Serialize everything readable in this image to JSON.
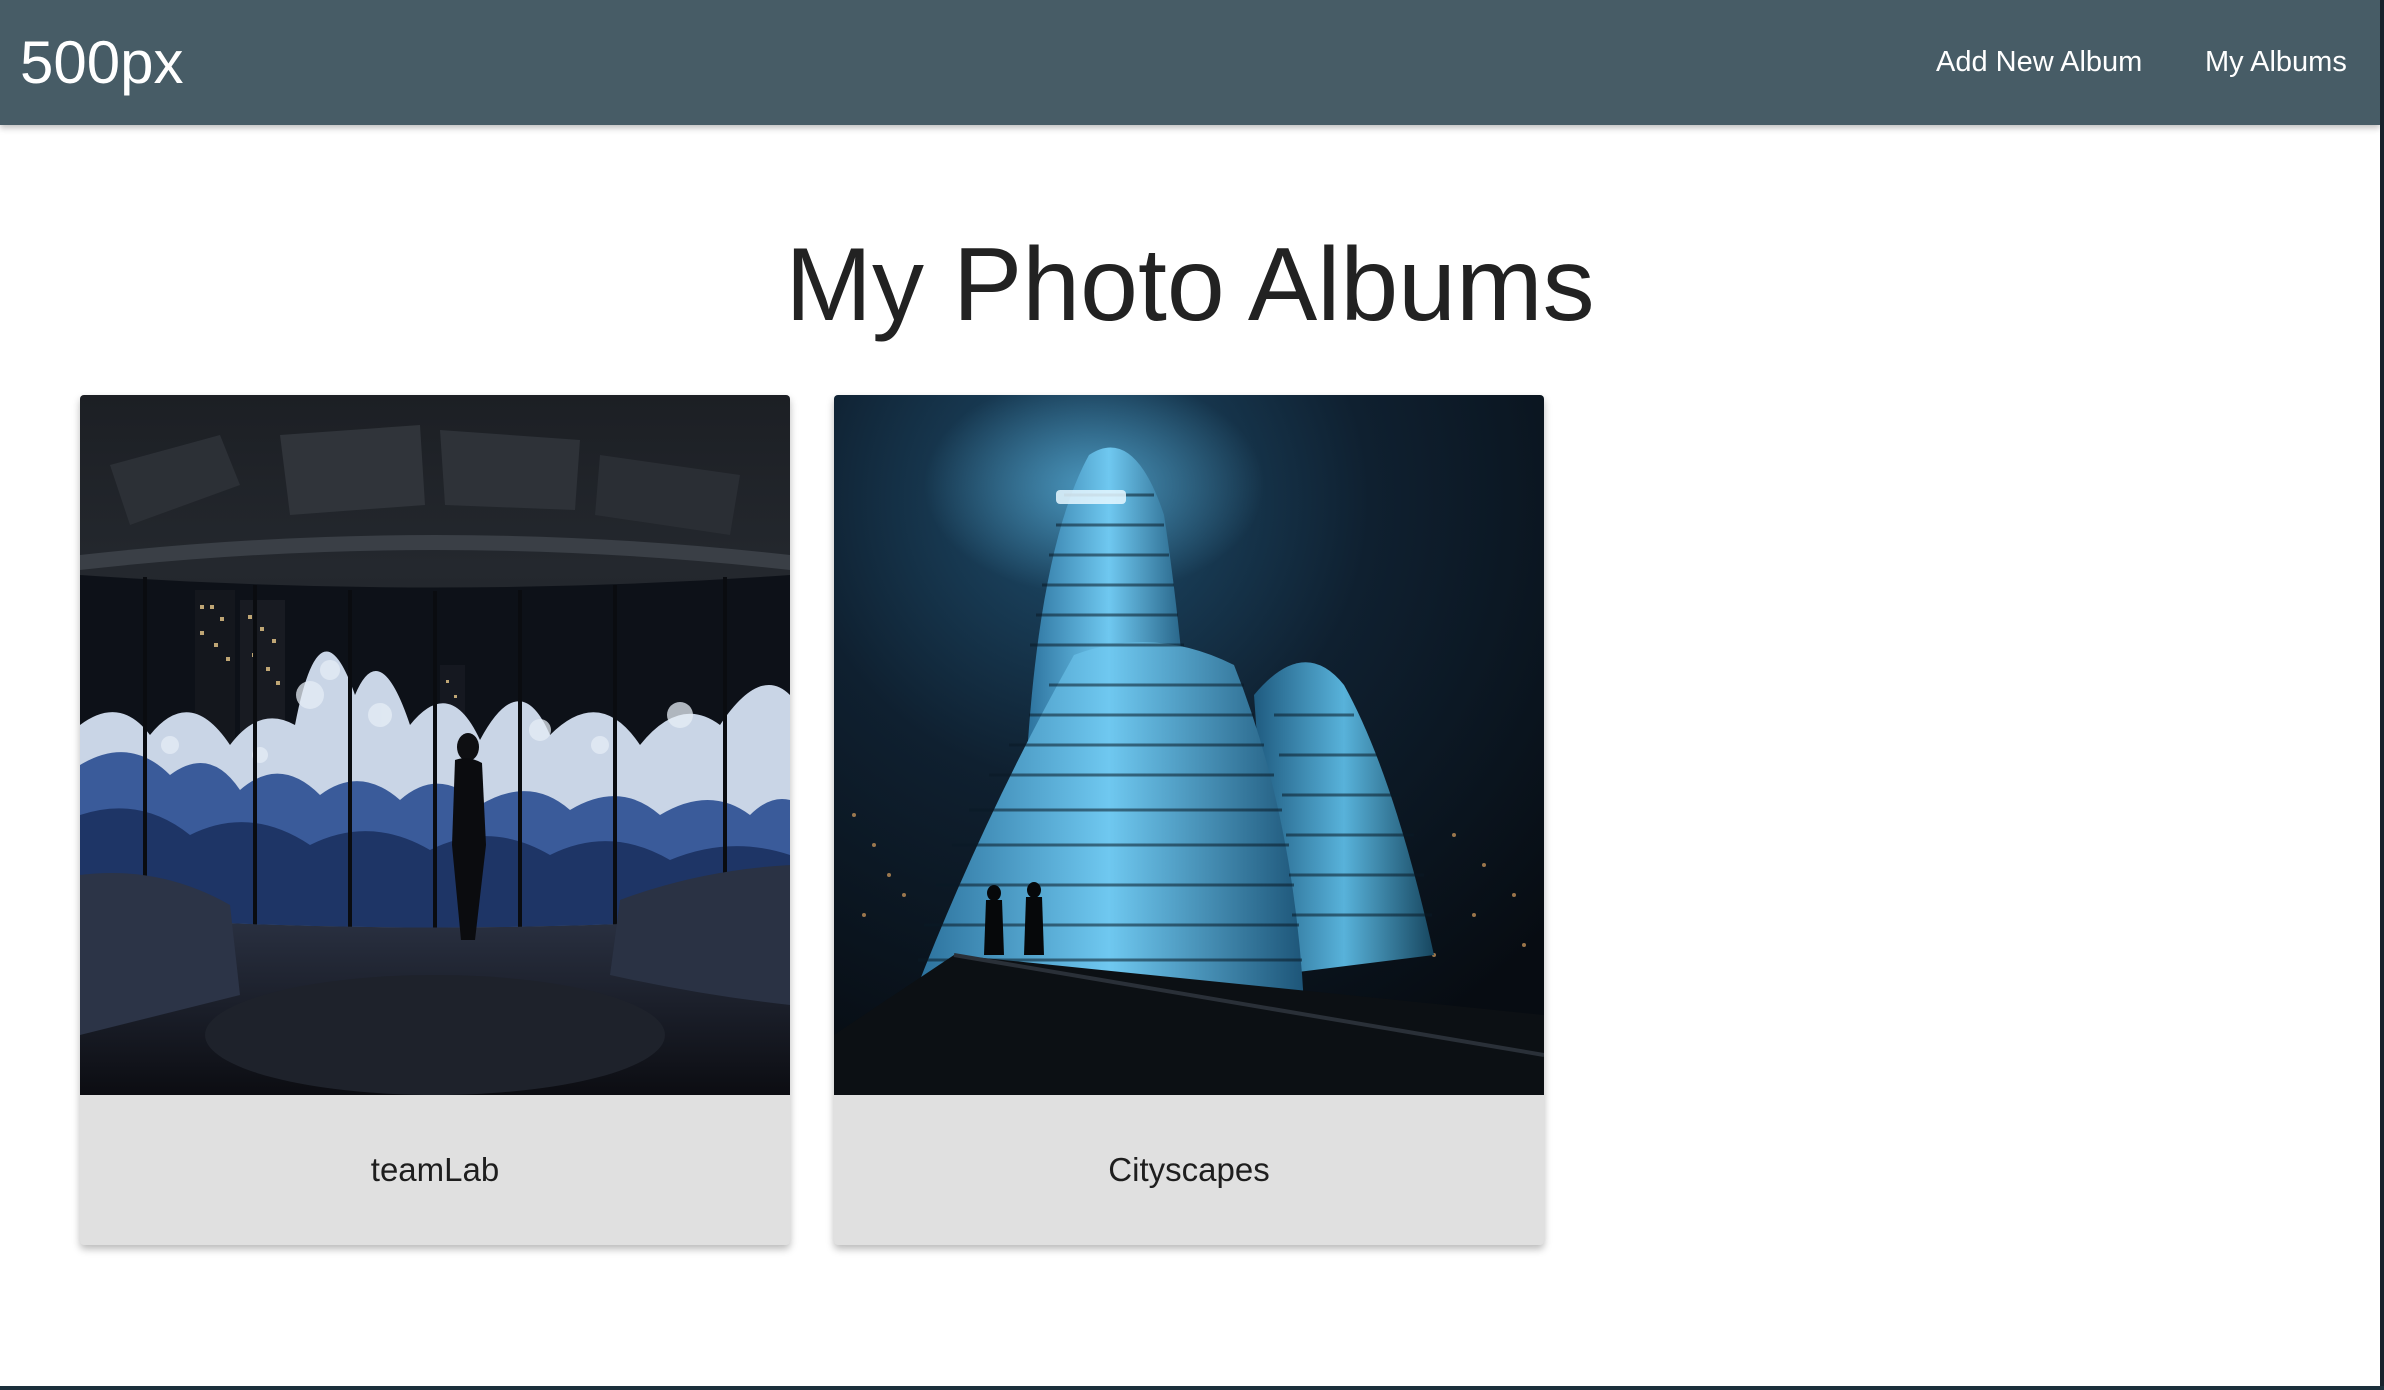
{
  "navbar": {
    "brand": "500px",
    "links": [
      {
        "label": "Add New Album"
      },
      {
        "label": "My Albums"
      }
    ],
    "background_color": "#475c66"
  },
  "main": {
    "title": "My Photo Albums",
    "albums": [
      {
        "name": "teamLab",
        "image": "dark gallery room with panoramic projected crashing waves over a night city skyline"
      },
      {
        "name": "Cityscapes",
        "image": "futuristic curved glowing blue towers at night seen from a rooftop"
      }
    ],
    "card_footer_color": "#e0e0e0"
  }
}
